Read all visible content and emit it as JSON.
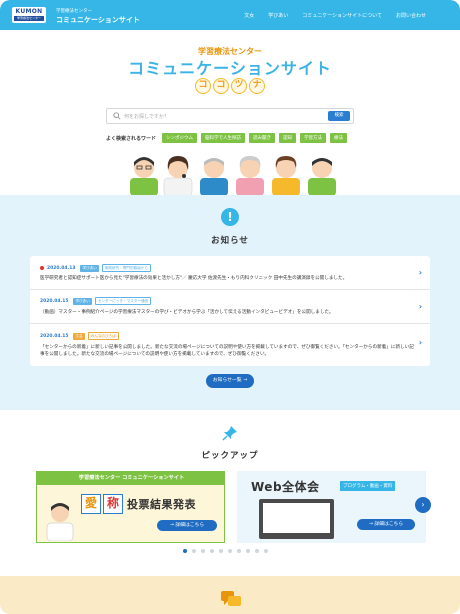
{
  "header": {
    "logo_text": "KUMON",
    "logo_sub": "学習療法センター",
    "site_small": "学習療法センター",
    "site_name": "コミュニケーションサイト",
    "nav": [
      "文女",
      "学びあい",
      "コミュニケーションサイトについて",
      "お問い合わせ"
    ]
  },
  "hero": {
    "subtitle": "学習療法センター",
    "title": "コミュニケーションサイト",
    "tagline_chars": [
      "コ",
      "コ",
      "ツ",
      "ナ"
    ]
  },
  "search": {
    "placeholder": "何をお探しですか？",
    "button_label": "検索"
  },
  "keywords": {
    "label": "よく検索されるワード",
    "items": [
      "シンポジウム",
      "脳科学で人生探訪",
      "読み聞き",
      "認知",
      "学習方法",
      "療法"
    ]
  },
  "news": {
    "title": "お知らせ",
    "items": [
      {
        "date": "2020.04.13",
        "new": true,
        "tags": [
          {
            "label": "学びあい",
            "style": "fill"
          },
          {
            "label": "実践研究・専門的取組から",
            "style": "out"
          }
        ],
        "text": "医学研究者と認知症サポート医から見た\"学習療法の効果と活かし方\"／ 慶応大学 佐渡先生・もり内科クリニック 田中先生の講演録を公開しました。"
      },
      {
        "date": "2020.04.15",
        "new": false,
        "tags": [
          {
            "label": "学びあい",
            "style": "fill"
          },
          {
            "label": "センターにっき・マスター通信",
            "style": "out"
          }
        ],
        "text": "（動画）マスター・事例紹介ページの学習療法マスターの学び・ビデオから学ぶ「活かして伝える活動インタビュービデオ」を公開しました。"
      },
      {
        "date": "2020.04.15",
        "new": false,
        "tags": [
          {
            "label": "文芸",
            "style": "orange"
          },
          {
            "label": "みんなのひろば",
            "style": "orange-out"
          }
        ],
        "text": "「センターからの新着」に新しい記事を公開しました。新たな交流の場ページについての説明や使い方を掲載していますので、ぜひ御覧ください。「センターからの新着」に新しい記事を公開しました。新たな交流の場ページについての説明や使い方を掲載していますので、ぜひ御覧ください。"
      }
    ],
    "more_label": "お知らせ一覧 →"
  },
  "pickup": {
    "title": "ピックアップ",
    "banner1": {
      "header": "学習療法センター コミュニケーションサイト",
      "chars": [
        "愛",
        "称"
      ],
      "headline": "投票結果発表",
      "button": "→ 詳細はこちら"
    },
    "banner2": {
      "title": "Web全体会",
      "tag": "プログラム・動画・資料",
      "button": "→ 詳細はこちら"
    },
    "next_label": "›",
    "dots_count": 10,
    "active_dot": 0
  },
  "colors": {
    "header_bg": "#35b6e6",
    "accent_blue": "#1f6cc2",
    "green": "#7ec243",
    "orange": "#e8950c",
    "news_bg": "#e3f3fb",
    "bottom_bg": "#fbeac6"
  },
  "icons": {
    "search": "search-icon",
    "alert": "exclamation-icon",
    "pin": "pushpin-icon",
    "chat": "chat-bubbles-icon",
    "chevron": "chevron-right-icon"
  }
}
